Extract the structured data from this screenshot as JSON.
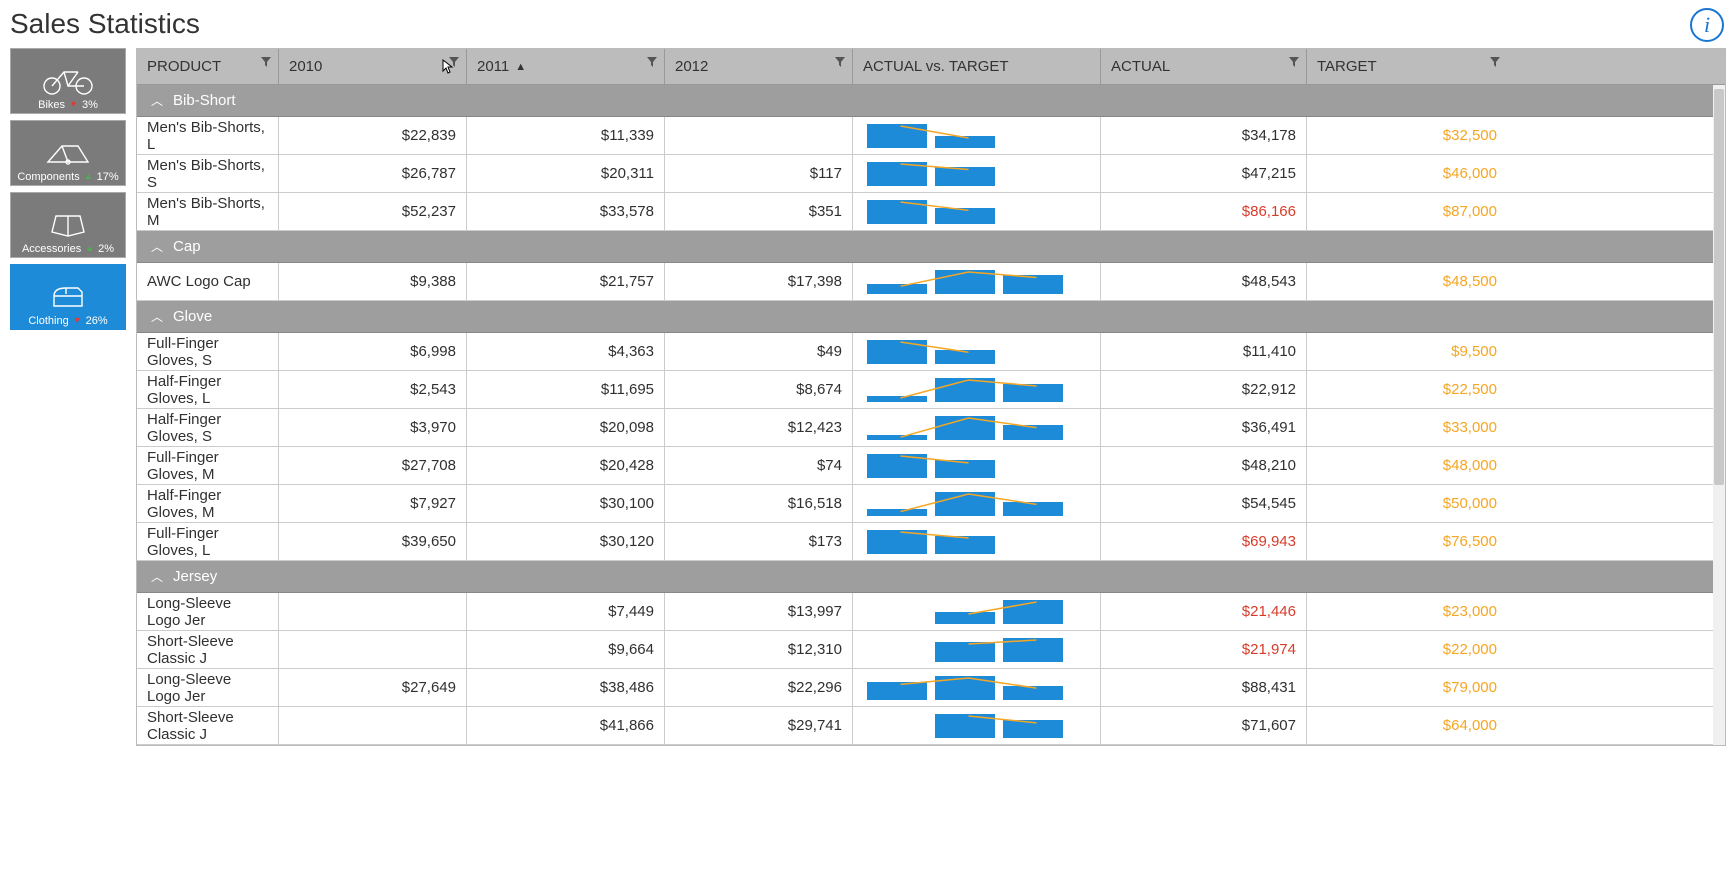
{
  "title": "Sales Statistics",
  "info_tooltip": "i",
  "sidebar": [
    {
      "label": "Bikes",
      "delta": "3%",
      "dir": "down"
    },
    {
      "label": "Components",
      "delta": "17%",
      "dir": "up"
    },
    {
      "label": "Accessories",
      "delta": "2%",
      "dir": "up"
    },
    {
      "label": "Clothing",
      "delta": "26%",
      "dir": "down",
      "active": true
    }
  ],
  "columns": {
    "product": "PRODUCT",
    "y2010": "2010",
    "y2011": "2011",
    "y2012": "2012",
    "avt": "ACTUAL vs. TARGET",
    "actual": "ACTUAL",
    "target": "TARGET",
    "sort_indicator": "▲"
  },
  "groups": [
    {
      "name": "Bib-Short",
      "rows": [
        {
          "product": "Men's Bib-Shorts, L",
          "y2010": "$22,839",
          "y2011": "$11,339",
          "y2012": "",
          "bars": [
            22,
            11,
            0
          ],
          "actual": "$34,178",
          "actual_red": false,
          "target": "$32,500"
        },
        {
          "product": "Men's Bib-Shorts, S",
          "y2010": "$26,787",
          "y2011": "$20,311",
          "y2012": "$117",
          "bars": [
            26,
            20,
            0
          ],
          "actual": "$47,215",
          "actual_red": false,
          "target": "$46,000"
        },
        {
          "product": "Men's Bib-Shorts, M",
          "y2010": "$52,237",
          "y2011": "$33,578",
          "y2012": "$351",
          "bars": [
            52,
            34,
            0
          ],
          "actual": "$86,166",
          "actual_red": true,
          "target": "$87,000"
        }
      ]
    },
    {
      "name": "Cap",
      "rows": [
        {
          "product": "AWC Logo Cap",
          "y2010": "$9,388",
          "y2011": "$21,757",
          "y2012": "$17,398",
          "bars": [
            9,
            22,
            17
          ],
          "actual": "$48,543",
          "actual_red": false,
          "target": "$48,500"
        }
      ]
    },
    {
      "name": "Glove",
      "rows": [
        {
          "product": "Full-Finger Gloves, S",
          "y2010": "$6,998",
          "y2011": "$4,363",
          "y2012": "$49",
          "bars": [
            7,
            4,
            0
          ],
          "actual": "$11,410",
          "actual_red": false,
          "target": "$9,500"
        },
        {
          "product": "Half-Finger Gloves, L",
          "y2010": "$2,543",
          "y2011": "$11,695",
          "y2012": "$8,674",
          "bars": [
            3,
            12,
            9
          ],
          "actual": "$22,912",
          "actual_red": false,
          "target": "$22,500"
        },
        {
          "product": "Half-Finger Gloves, S",
          "y2010": "$3,970",
          "y2011": "$20,098",
          "y2012": "$12,423",
          "bars": [
            4,
            20,
            12
          ],
          "actual": "$36,491",
          "actual_red": false,
          "target": "$33,000"
        },
        {
          "product": "Full-Finger Gloves, M",
          "y2010": "$27,708",
          "y2011": "$20,428",
          "y2012": "$74",
          "bars": [
            28,
            20,
            0
          ],
          "actual": "$48,210",
          "actual_red": false,
          "target": "$48,000"
        },
        {
          "product": "Half-Finger Gloves, M",
          "y2010": "$7,927",
          "y2011": "$30,100",
          "y2012": "$16,518",
          "bars": [
            8,
            30,
            17
          ],
          "actual": "$54,545",
          "actual_red": false,
          "target": "$50,000"
        },
        {
          "product": "Full-Finger Gloves, L",
          "y2010": "$39,650",
          "y2011": "$30,120",
          "y2012": "$173",
          "bars": [
            40,
            30,
            0
          ],
          "actual": "$69,943",
          "actual_red": true,
          "target": "$76,500"
        }
      ]
    },
    {
      "name": "Jersey",
      "rows": [
        {
          "product": "Long-Sleeve Logo Jer",
          "y2010": "",
          "y2011": "$7,449",
          "y2012": "$13,997",
          "bars": [
            0,
            7,
            14
          ],
          "actual": "$21,446",
          "actual_red": true,
          "target": "$23,000"
        },
        {
          "product": "Short-Sleeve Classic J",
          "y2010": "",
          "y2011": "$9,664",
          "y2012": "$12,310",
          "bars": [
            0,
            10,
            12
          ],
          "actual": "$21,974",
          "actual_red": true,
          "target": "$22,000"
        },
        {
          "product": "Long-Sleeve Logo Jer",
          "y2010": "$27,649",
          "y2011": "$38,486",
          "y2012": "$22,296",
          "bars": [
            28,
            38,
            22
          ],
          "actual": "$88,431",
          "actual_red": false,
          "target": "$79,000"
        },
        {
          "product": "Short-Sleeve Classic J",
          "y2010": "",
          "y2011": "$41,866",
          "y2012": "$29,741",
          "bars": [
            0,
            42,
            30
          ],
          "actual": "$71,607",
          "actual_red": false,
          "target": "$64,000"
        }
      ]
    }
  ],
  "chart_data": {
    "type": "table",
    "note": "Per-row inline sparkline mini-bar-charts comparing 2010/2011/2012 sales; scaled per-row to max bar value.",
    "columns": [
      "2010",
      "2011",
      "2012",
      "ACTUAL",
      "TARGET"
    ],
    "series": [
      {
        "name": "Men's Bib-Shorts, L",
        "values": [
          22839,
          11339,
          null,
          34178,
          32500
        ]
      },
      {
        "name": "Men's Bib-Shorts, S",
        "values": [
          26787,
          20311,
          117,
          47215,
          46000
        ]
      },
      {
        "name": "Men's Bib-Shorts, M",
        "values": [
          52237,
          33578,
          351,
          86166,
          87000
        ]
      },
      {
        "name": "AWC Logo Cap",
        "values": [
          9388,
          21757,
          17398,
          48543,
          48500
        ]
      },
      {
        "name": "Full-Finger Gloves, S",
        "values": [
          6998,
          4363,
          49,
          11410,
          9500
        ]
      },
      {
        "name": "Half-Finger Gloves, L",
        "values": [
          2543,
          11695,
          8674,
          22912,
          22500
        ]
      },
      {
        "name": "Half-Finger Gloves, S",
        "values": [
          3970,
          20098,
          12423,
          36491,
          33000
        ]
      },
      {
        "name": "Full-Finger Gloves, M",
        "values": [
          27708,
          20428,
          74,
          48210,
          48000
        ]
      },
      {
        "name": "Half-Finger Gloves, M",
        "values": [
          7927,
          30100,
          16518,
          54545,
          50000
        ]
      },
      {
        "name": "Full-Finger Gloves, L",
        "values": [
          39650,
          30120,
          173,
          69943,
          76500
        ]
      },
      {
        "name": "Long-Sleeve Logo Jer",
        "values": [
          null,
          7449,
          13997,
          21446,
          23000
        ]
      },
      {
        "name": "Short-Sleeve Classic J",
        "values": [
          null,
          9664,
          12310,
          21974,
          22000
        ]
      },
      {
        "name": "Long-Sleeve Logo Jer",
        "values": [
          27649,
          38486,
          22296,
          88431,
          79000
        ]
      },
      {
        "name": "Short-Sleeve Classic J",
        "values": [
          null,
          41866,
          29741,
          71607,
          64000
        ]
      }
    ]
  }
}
